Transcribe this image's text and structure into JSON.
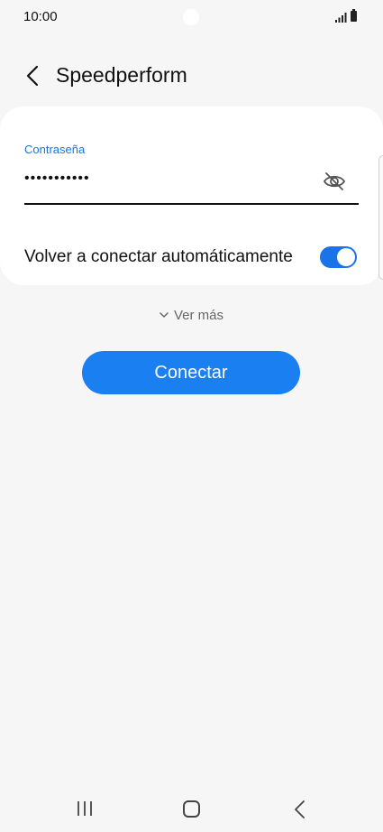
{
  "status_bar": {
    "time": "10:00",
    "icons": [
      "camera-dot",
      "signal-icon",
      "battery-icon"
    ]
  },
  "header": {
    "back_icon": "chevron-left-icon",
    "title": "Speedperform"
  },
  "password_field": {
    "label": "Contraseña",
    "value": "•••••••••••",
    "visibility_icon": "eye-off-icon"
  },
  "auto_reconnect": {
    "label": "Volver a conectar automáticamente",
    "enabled": true
  },
  "more": {
    "icon": "chevron-down-icon",
    "label": "Ver más"
  },
  "connect_button": {
    "label": "Conectar"
  },
  "nav_bar": {
    "icons": [
      "recents-icon",
      "home-icon",
      "back-icon"
    ]
  },
  "colors": {
    "accent": "#1a73e8",
    "button": "#1a7ff0",
    "background": "#f6f6f6",
    "card": "#ffffff"
  }
}
